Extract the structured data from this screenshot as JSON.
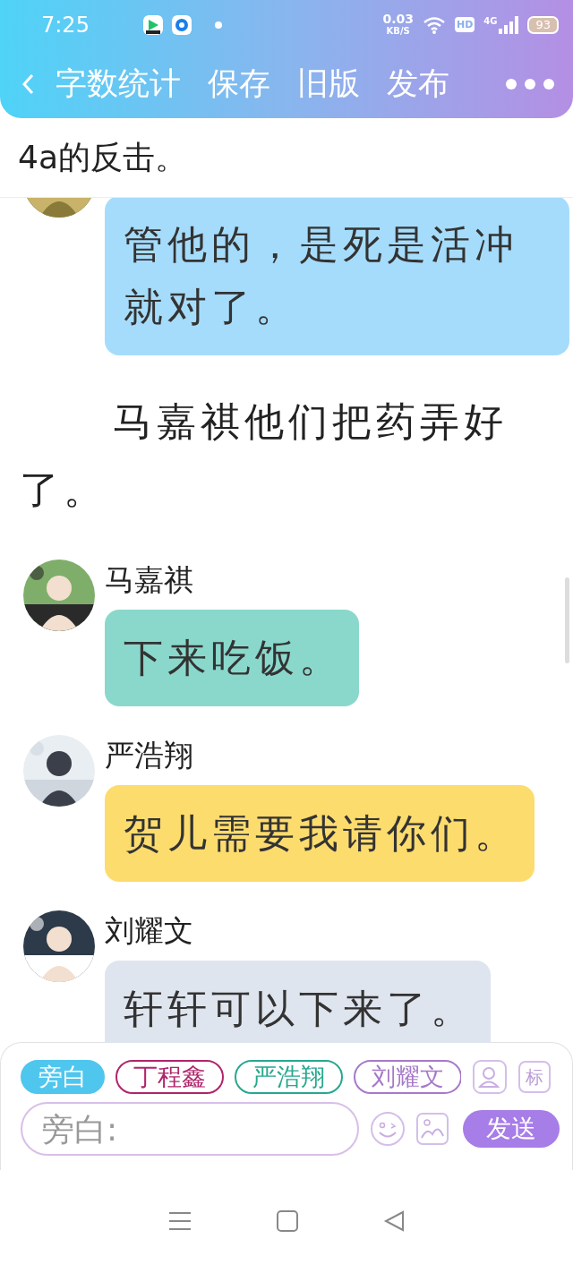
{
  "status_bar": {
    "time": "7:25",
    "speed": "0.03",
    "speed_unit": "KB/S",
    "hd": "HD",
    "network": "4G",
    "battery": "93"
  },
  "toolbar": {
    "items": [
      "字数统计",
      "保存",
      "旧版",
      "发布"
    ]
  },
  "chapter_title": "4a的反击。",
  "messages": [
    {
      "kind": "message",
      "text": "管他的，是死是活冲就对了。",
      "color": "#a6dcfb"
    },
    {
      "kind": "narration",
      "text": "马嘉祺他们把药弄好了。"
    },
    {
      "kind": "message",
      "name": "马嘉祺",
      "text": "下来吃饭。",
      "color": "#8ad8cc"
    },
    {
      "kind": "message",
      "name": "严浩翔",
      "text": "贺儿需要我请你们。",
      "color": "#fddc6e"
    },
    {
      "kind": "message",
      "name": "刘耀文",
      "text": "轩轩可以下来了。",
      "color": "#dfe5ee"
    }
  ],
  "input_panel": {
    "roles": [
      {
        "label": "旁白",
        "selected": true,
        "color": "#4fc6ee"
      },
      {
        "label": "丁程鑫",
        "selected": false,
        "color": "#b0246a"
      },
      {
        "label": "严浩翔",
        "selected": false,
        "color": "#27a88f"
      },
      {
        "label": "刘耀文",
        "selected": false,
        "color": "#a679c9"
      }
    ],
    "tag_button": "标",
    "placeholder": "旁白:",
    "send": "发送"
  }
}
